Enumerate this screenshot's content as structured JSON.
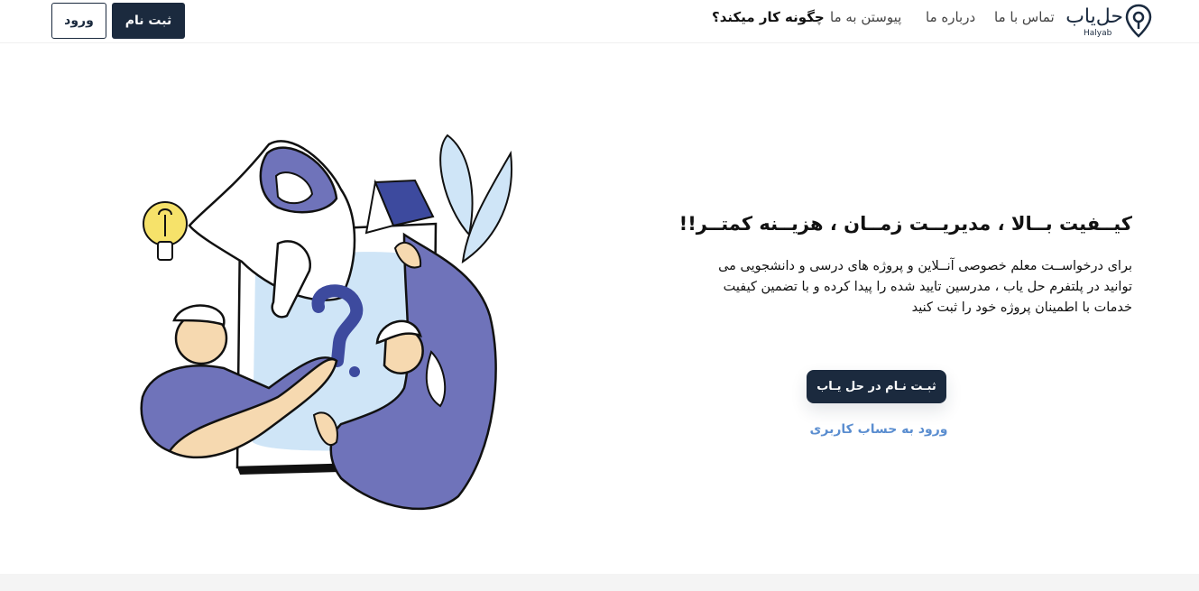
{
  "navbar": {
    "logo": {
      "word": "حل‌یاب",
      "latin": "Halyab"
    },
    "links": [
      {
        "id": "contact",
        "label": "تماس با ما"
      },
      {
        "id": "about",
        "label": "درباره ما"
      },
      {
        "id": "join",
        "label": "پیوستن به ما"
      },
      {
        "id": "how",
        "label": "چگونه کار میکند؟"
      }
    ],
    "register_label": "ثبت نام",
    "login_label": "ورود"
  },
  "hero": {
    "title": "کیــفیت بــالا ، مدیریــت زمــان ، هزیــنه کمتــر!!",
    "description": "برای درخواســت معلم خصوصی آنــلاین و پروژه های درسی و دانشجویی می توانید در پلتفرم حل یاب ، مدرسین تایید شده را پیدا کرده و با تضمین کیفیت خدمات با اطمینان پروژه خود را ثبت کنید",
    "cta_register": "ثبـت نـام در حل یـاب",
    "cta_login": "ورود به حساب کاربری"
  },
  "colors": {
    "primary_dark": "#1b2a3e",
    "accent_blue": "#5b8ed0",
    "illustration_purple": "#6f73ba",
    "illustration_lightblue": "#cfe5f7",
    "bulb_yellow": "#f6e26a"
  }
}
